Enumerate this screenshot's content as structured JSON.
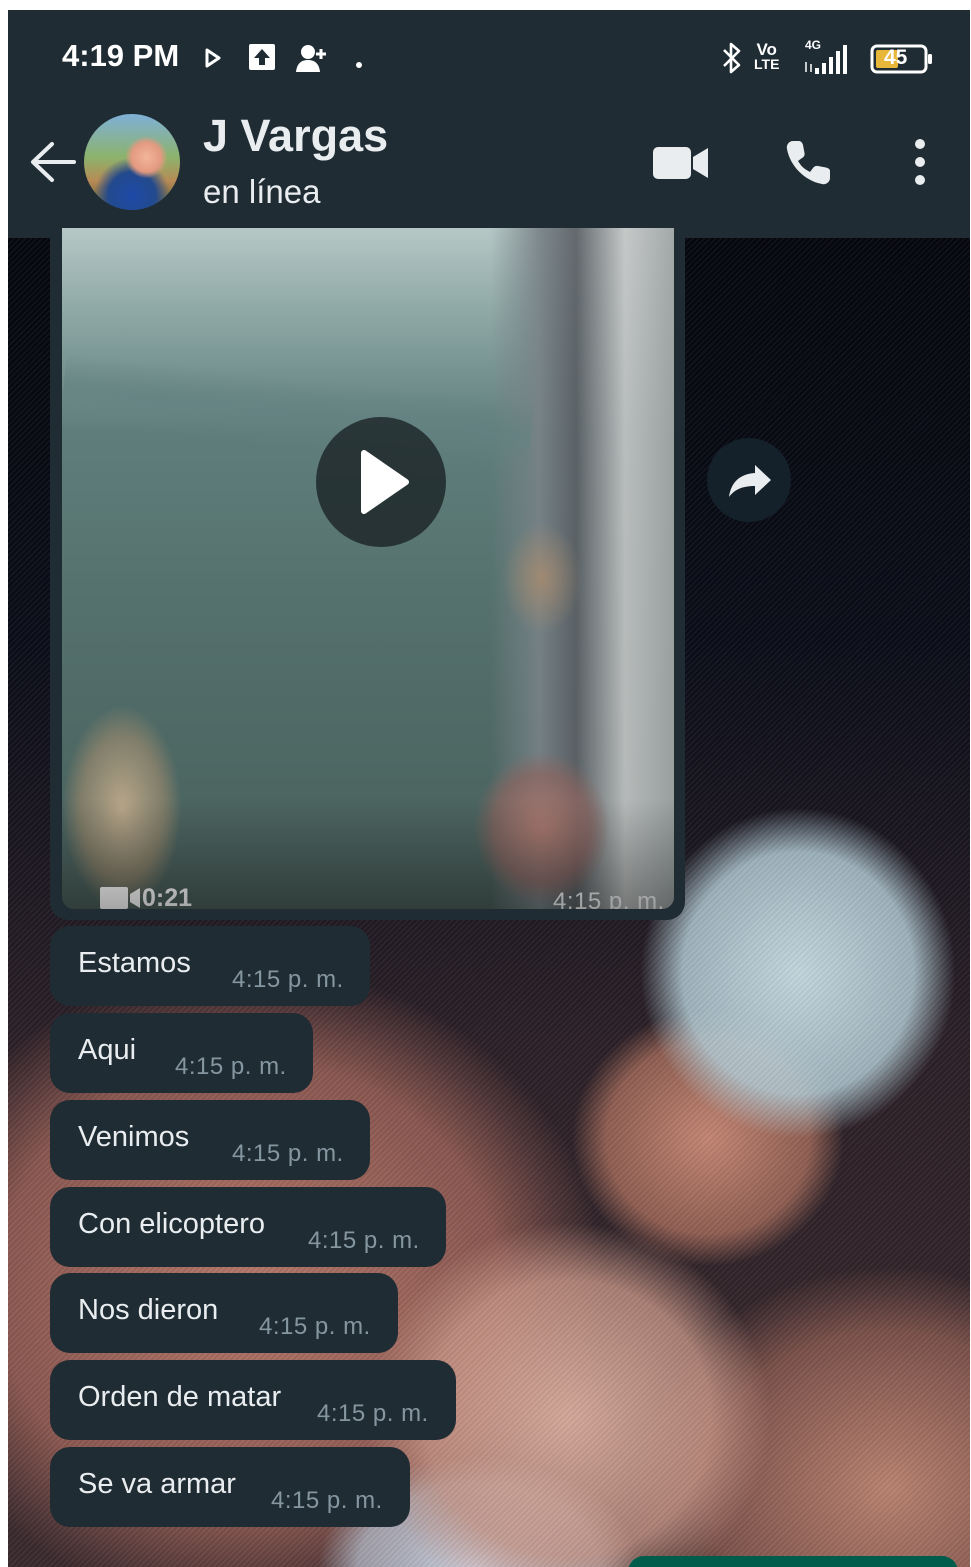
{
  "status_bar": {
    "time": "4:19 PM",
    "icons": [
      "play-store-icon",
      "upload-icon",
      "person-add-icon",
      "dot-icon",
      "bluetooth-icon",
      "volte-icon",
      "signal-4g-icon",
      "battery-icon"
    ],
    "volte_text": "Vo",
    "lte_text": "LTE",
    "network": "4G",
    "battery": "45"
  },
  "header": {
    "contact_name": "J Vargas",
    "status": "en línea",
    "actions": [
      "video-call-icon",
      "voice-call-icon",
      "more-options-icon"
    ]
  },
  "video_message": {
    "duration": "0:21",
    "time": "4:15 p. m."
  },
  "messages": [
    {
      "text": "Estamos",
      "time": "4:15 p. m."
    },
    {
      "text": "Aqui",
      "time": "4:15 p. m."
    },
    {
      "text": "Venimos",
      "time": "4:15 p. m."
    },
    {
      "text": "Con elicoptero",
      "time": "4:15 p. m."
    },
    {
      "text": "Nos dieron",
      "time": "4:15 p. m."
    },
    {
      "text": "Orden de matar",
      "time": "4:15 p. m."
    },
    {
      "text": "Se va armar",
      "time": "4:15 p. m."
    }
  ],
  "colors": {
    "header_bg": "#1f2c34",
    "bubble_bg": "#1f2c34",
    "text_primary": "#e9edef",
    "text_secondary": "#8696a0",
    "outgoing_bubble": "#005c4b"
  }
}
